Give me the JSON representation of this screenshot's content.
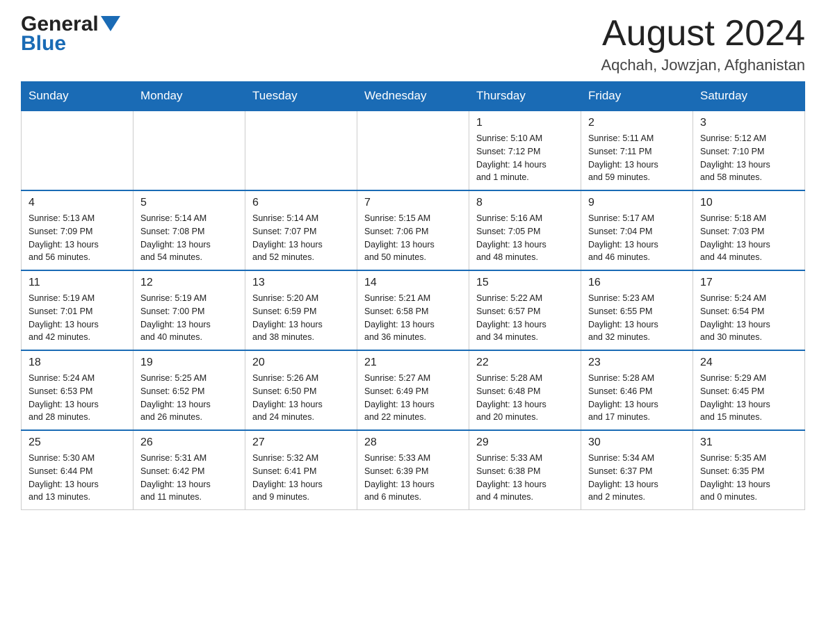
{
  "logo": {
    "general": "General",
    "blue": "Blue"
  },
  "title": "August 2024",
  "subtitle": "Aqchah, Jowzjan, Afghanistan",
  "days_of_week": [
    "Sunday",
    "Monday",
    "Tuesday",
    "Wednesday",
    "Thursday",
    "Friday",
    "Saturday"
  ],
  "weeks": [
    [
      {
        "day": "",
        "info": ""
      },
      {
        "day": "",
        "info": ""
      },
      {
        "day": "",
        "info": ""
      },
      {
        "day": "",
        "info": ""
      },
      {
        "day": "1",
        "info": "Sunrise: 5:10 AM\nSunset: 7:12 PM\nDaylight: 14 hours\nand 1 minute."
      },
      {
        "day": "2",
        "info": "Sunrise: 5:11 AM\nSunset: 7:11 PM\nDaylight: 13 hours\nand 59 minutes."
      },
      {
        "day": "3",
        "info": "Sunrise: 5:12 AM\nSunset: 7:10 PM\nDaylight: 13 hours\nand 58 minutes."
      }
    ],
    [
      {
        "day": "4",
        "info": "Sunrise: 5:13 AM\nSunset: 7:09 PM\nDaylight: 13 hours\nand 56 minutes."
      },
      {
        "day": "5",
        "info": "Sunrise: 5:14 AM\nSunset: 7:08 PM\nDaylight: 13 hours\nand 54 minutes."
      },
      {
        "day": "6",
        "info": "Sunrise: 5:14 AM\nSunset: 7:07 PM\nDaylight: 13 hours\nand 52 minutes."
      },
      {
        "day": "7",
        "info": "Sunrise: 5:15 AM\nSunset: 7:06 PM\nDaylight: 13 hours\nand 50 minutes."
      },
      {
        "day": "8",
        "info": "Sunrise: 5:16 AM\nSunset: 7:05 PM\nDaylight: 13 hours\nand 48 minutes."
      },
      {
        "day": "9",
        "info": "Sunrise: 5:17 AM\nSunset: 7:04 PM\nDaylight: 13 hours\nand 46 minutes."
      },
      {
        "day": "10",
        "info": "Sunrise: 5:18 AM\nSunset: 7:03 PM\nDaylight: 13 hours\nand 44 minutes."
      }
    ],
    [
      {
        "day": "11",
        "info": "Sunrise: 5:19 AM\nSunset: 7:01 PM\nDaylight: 13 hours\nand 42 minutes."
      },
      {
        "day": "12",
        "info": "Sunrise: 5:19 AM\nSunset: 7:00 PM\nDaylight: 13 hours\nand 40 minutes."
      },
      {
        "day": "13",
        "info": "Sunrise: 5:20 AM\nSunset: 6:59 PM\nDaylight: 13 hours\nand 38 minutes."
      },
      {
        "day": "14",
        "info": "Sunrise: 5:21 AM\nSunset: 6:58 PM\nDaylight: 13 hours\nand 36 minutes."
      },
      {
        "day": "15",
        "info": "Sunrise: 5:22 AM\nSunset: 6:57 PM\nDaylight: 13 hours\nand 34 minutes."
      },
      {
        "day": "16",
        "info": "Sunrise: 5:23 AM\nSunset: 6:55 PM\nDaylight: 13 hours\nand 32 minutes."
      },
      {
        "day": "17",
        "info": "Sunrise: 5:24 AM\nSunset: 6:54 PM\nDaylight: 13 hours\nand 30 minutes."
      }
    ],
    [
      {
        "day": "18",
        "info": "Sunrise: 5:24 AM\nSunset: 6:53 PM\nDaylight: 13 hours\nand 28 minutes."
      },
      {
        "day": "19",
        "info": "Sunrise: 5:25 AM\nSunset: 6:52 PM\nDaylight: 13 hours\nand 26 minutes."
      },
      {
        "day": "20",
        "info": "Sunrise: 5:26 AM\nSunset: 6:50 PM\nDaylight: 13 hours\nand 24 minutes."
      },
      {
        "day": "21",
        "info": "Sunrise: 5:27 AM\nSunset: 6:49 PM\nDaylight: 13 hours\nand 22 minutes."
      },
      {
        "day": "22",
        "info": "Sunrise: 5:28 AM\nSunset: 6:48 PM\nDaylight: 13 hours\nand 20 minutes."
      },
      {
        "day": "23",
        "info": "Sunrise: 5:28 AM\nSunset: 6:46 PM\nDaylight: 13 hours\nand 17 minutes."
      },
      {
        "day": "24",
        "info": "Sunrise: 5:29 AM\nSunset: 6:45 PM\nDaylight: 13 hours\nand 15 minutes."
      }
    ],
    [
      {
        "day": "25",
        "info": "Sunrise: 5:30 AM\nSunset: 6:44 PM\nDaylight: 13 hours\nand 13 minutes."
      },
      {
        "day": "26",
        "info": "Sunrise: 5:31 AM\nSunset: 6:42 PM\nDaylight: 13 hours\nand 11 minutes."
      },
      {
        "day": "27",
        "info": "Sunrise: 5:32 AM\nSunset: 6:41 PM\nDaylight: 13 hours\nand 9 minutes."
      },
      {
        "day": "28",
        "info": "Sunrise: 5:33 AM\nSunset: 6:39 PM\nDaylight: 13 hours\nand 6 minutes."
      },
      {
        "day": "29",
        "info": "Sunrise: 5:33 AM\nSunset: 6:38 PM\nDaylight: 13 hours\nand 4 minutes."
      },
      {
        "day": "30",
        "info": "Sunrise: 5:34 AM\nSunset: 6:37 PM\nDaylight: 13 hours\nand 2 minutes."
      },
      {
        "day": "31",
        "info": "Sunrise: 5:35 AM\nSunset: 6:35 PM\nDaylight: 13 hours\nand 0 minutes."
      }
    ]
  ]
}
